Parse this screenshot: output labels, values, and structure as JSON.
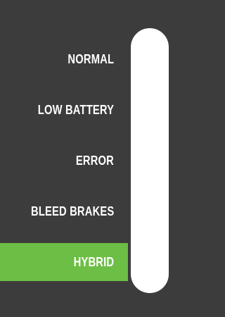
{
  "mode_selector": {
    "items": [
      {
        "label": "NORMAL",
        "selected": false
      },
      {
        "label": "LOW BATTERY",
        "selected": false
      },
      {
        "label": "ERROR",
        "selected": false
      },
      {
        "label": "BLEED BRAKES",
        "selected": false
      },
      {
        "label": "HYBRID",
        "selected": true
      }
    ],
    "selected_label": "HYBRID"
  },
  "colors": {
    "background": "#3c3c3c",
    "selected_highlight": "#6cbe45",
    "track": "#ffffff",
    "label_text": "#ffffff"
  }
}
